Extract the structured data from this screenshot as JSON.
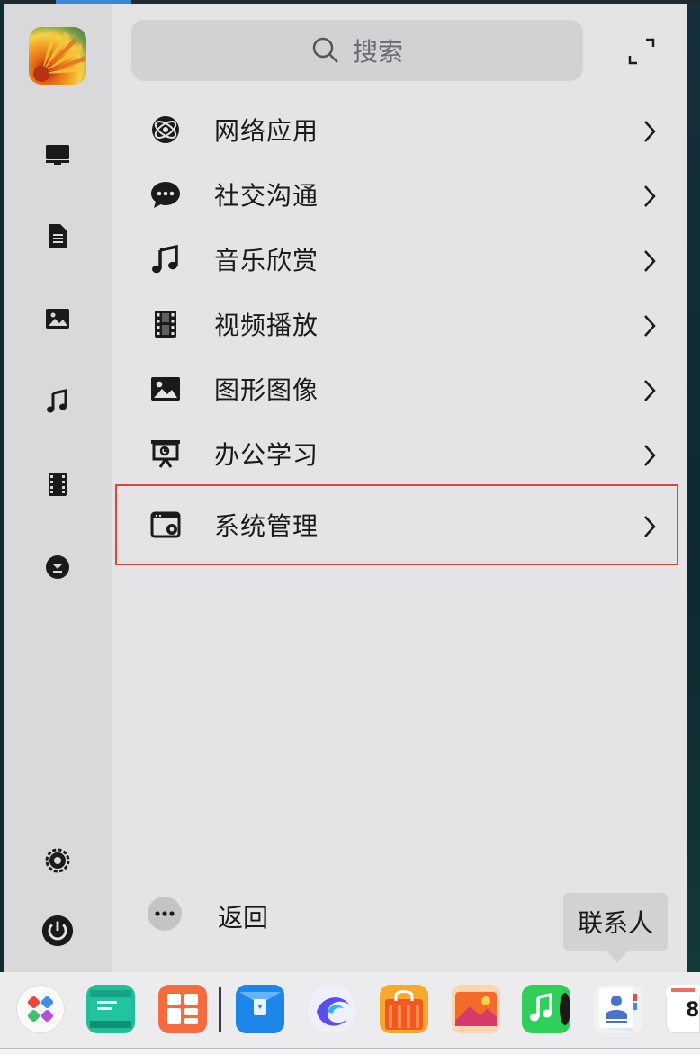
{
  "search": {
    "placeholder": "搜索"
  },
  "categories": [
    {
      "label": "网络应用",
      "icon": "network-globe-icon"
    },
    {
      "label": "社交沟通",
      "icon": "chat-bubble-icon"
    },
    {
      "label": "音乐欣赏",
      "icon": "music-note-icon"
    },
    {
      "label": "视频播放",
      "icon": "film-icon"
    },
    {
      "label": "图形图像",
      "icon": "image-icon"
    },
    {
      "label": "办公学习",
      "icon": "presentation-board-icon"
    },
    {
      "label": "系统管理",
      "icon": "system-settings-window-icon"
    }
  ],
  "back": {
    "label": "返回"
  },
  "tooltip": {
    "label": "联系人"
  },
  "rail": [
    "computer-icon",
    "document-icon",
    "image-icon",
    "music-note-icon",
    "film-icon",
    "download-icon",
    "settings-gear-icon",
    "power-icon"
  ],
  "dock": {
    "apps": [
      "launcher-app",
      "file-manager-app",
      "app-store-grid-app",
      "mail-app",
      "browser-app",
      "shop-app",
      "photos-app",
      "music-app",
      "contacts-app",
      "calendar-app"
    ],
    "calendar_day": "8"
  },
  "colors": {
    "highlight_border": "#e0443a",
    "accent": "#3b86d6"
  }
}
